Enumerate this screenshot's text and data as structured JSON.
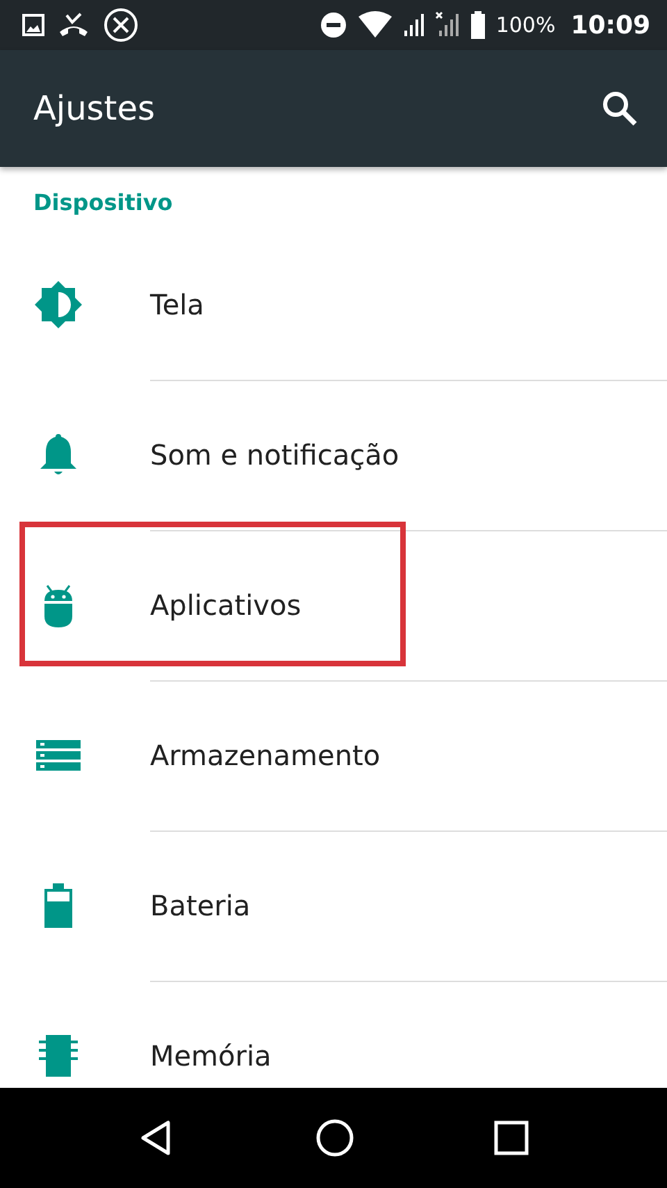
{
  "status_bar": {
    "battery_text": "100%",
    "time": "10:09"
  },
  "app_bar": {
    "title": "Ajustes"
  },
  "section": {
    "title": "Dispositivo"
  },
  "items": [
    {
      "label": "Tela",
      "kind": "brightness",
      "highlighted": false
    },
    {
      "label": "Som e notificação",
      "kind": "bell",
      "highlighted": false
    },
    {
      "label": "Aplicativos",
      "kind": "android",
      "highlighted": true
    },
    {
      "label": "Armazenamento",
      "kind": "storage",
      "highlighted": false
    },
    {
      "label": "Bateria",
      "kind": "battery",
      "highlighted": false
    },
    {
      "label": "Memória",
      "kind": "memory",
      "highlighted": false
    }
  ]
}
